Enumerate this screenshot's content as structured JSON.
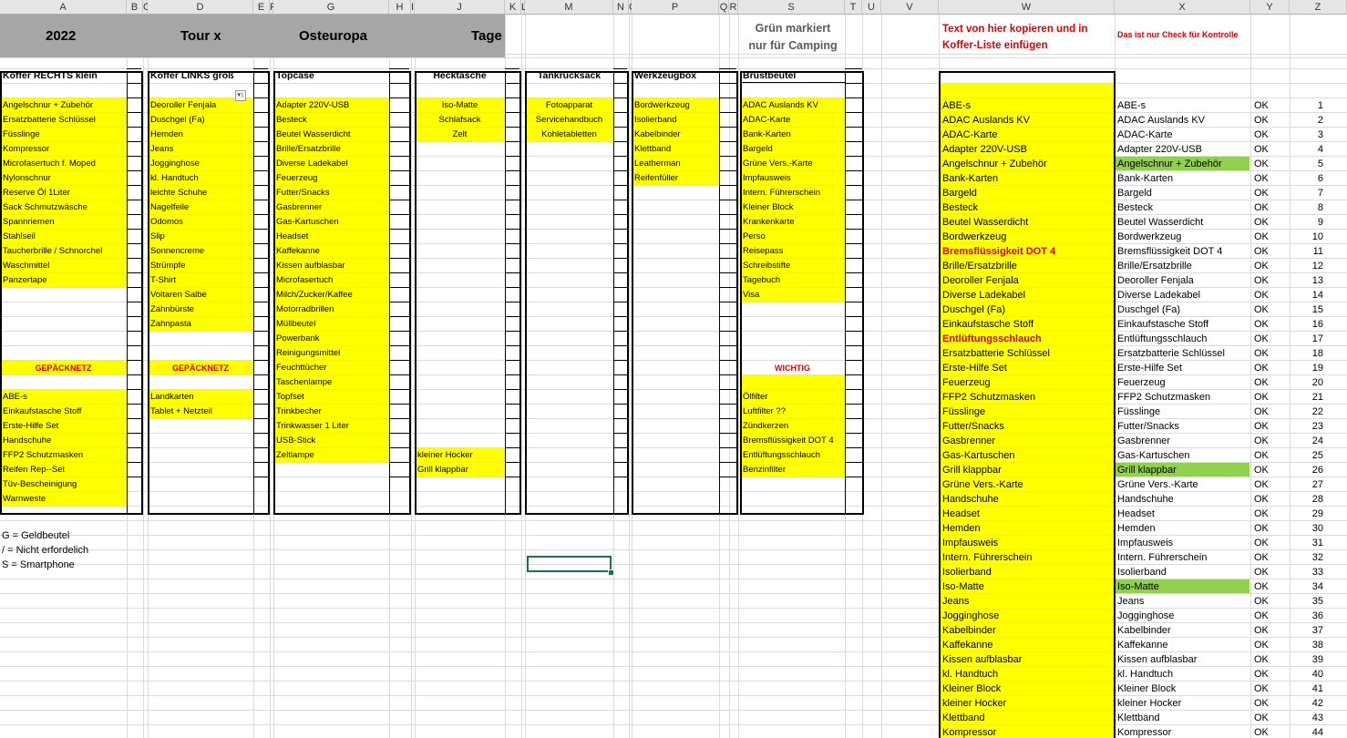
{
  "column_headers": [
    "A",
    "B",
    "C",
    "D",
    "E",
    "F",
    "G",
    "H",
    "I",
    "J",
    "K",
    "L",
    "M",
    "N",
    "O",
    "P",
    "Q",
    "R",
    "S",
    "T",
    "U",
    "V",
    "W",
    "X",
    "Y",
    "Z"
  ],
  "banner": {
    "year": "2022",
    "tour": "Tour x",
    "region": "Osteuropa",
    "days": "Tage"
  },
  "green_note": [
    "Grün markiert",
    "nur für Camping"
  ],
  "copy_note": [
    "Text von hier kopieren und in",
    "Koffer-Liste einfügen"
  ],
  "check_note": "Das ist nur Check für Kontrolle",
  "filter_icon": "sort-filter-icon",
  "colors": {
    "yellow": "#ffff00",
    "green": "#92d050",
    "banner": "#a6a6a6",
    "red": "#e00000",
    "selection": "#1e7145"
  },
  "legend": [
    "G = Geldbeutel",
    "/ = Nicht erfordelich",
    "S = Smartphone"
  ],
  "boxes": {
    "koffer_rechts": {
      "title": "Koffer RECHTS klein",
      "items": [
        "Angelschnur + Zubehör",
        "Ersatzbatterie Schlüssel",
        "Füsslinge",
        "Kompressor",
        "Microfasertuch f. Moped",
        "Nylonschnur",
        "Reserve Öl  1Liter",
        "Sack Schmutzwäsche",
        "Spannriemen",
        "Stahlseil",
        "Taucherbrille / Schnorchel",
        "Waschmittel",
        "Panzertape"
      ],
      "section": "GEPÄCKNETZ",
      "section_items": [
        "ABE-s",
        "Einkaufstasche Stoff",
        "Erste-Hilfe Set",
        "Handschuhe",
        "FFP2 Schutzmasken",
        "Reifen Rep--Set",
        "Tüv-Bescheinigung",
        "Warnweste"
      ]
    },
    "koffer_links": {
      "title": "Koffer LINKS groß",
      "items": [
        "Deoroller Fenjala",
        "Duschgel (Fa)",
        "Hemden",
        "Jeans",
        "Jogginghose",
        "kl. Handtuch",
        "leichte Schuhe",
        "Nagelfeile",
        "Odomos",
        "Slip",
        "Sonnencreme",
        "Strümpfe",
        "T-Shirt",
        "Voltaren Salbe",
        "Zahnbürste",
        "Zahnpasta"
      ],
      "section": "GEPÄCKNETZ",
      "section_items": [
        "Landkarten",
        "Tablet + Netzteil"
      ]
    },
    "topcase": {
      "title": "Topcase",
      "items": [
        "Adapter 220V-USB",
        "Besteck",
        "Beutel Wasserdicht",
        "Brille/Ersatzbrille",
        "Diverse Ladekabel",
        "Feuerzeug",
        "Futter/Snacks",
        "Gasbrenner",
        "Gas-Kartuschen",
        "Headset",
        "Kaffekanne",
        "Kissen aufblasbar",
        "Microfasertuch",
        "Milch/Zucker/Kaffee",
        "Motorradbrillen",
        "Müllbeutel",
        "Powerbank",
        "Reinigungsmittel",
        "Feuchttücher",
        "Taschenlampe",
        "Topfset",
        "Trinkbecher",
        "Trinkwasser 1 Liter",
        "USB-Stick",
        "Zeltlampe"
      ]
    },
    "hecktasche": {
      "title": "Hecktasche",
      "items": [
        "Iso-Matte",
        "Schlafsack",
        "Zelt"
      ],
      "bottom_items": [
        "kleiner Hocker",
        "Grill klappbar"
      ]
    },
    "tankrucksack": {
      "title": "Tankrucksack",
      "items": [
        "Fotoapparat",
        "Servicehandbuch",
        "Kohletabletten"
      ]
    },
    "werkzeugbox": {
      "title": "Werkzeugbox",
      "items": [
        "Bordwerkzeug",
        "Isolierband",
        "Kabelbinder",
        "Klettband",
        "Leatherman",
        "Reifenfüller"
      ]
    },
    "brustbeutel": {
      "title": "Brustbeutel",
      "items": [
        "ADAC Auslands KV",
        "ADAC-Karte",
        "Bank-Karten",
        "Bargeld",
        "Grüne Vers.-Karte",
        "Impfausweis",
        "Intern. Führerschein",
        "Kleiner Block",
        "Krankenkarte",
        "Perso",
        "Reisepass",
        "Schreibstifte",
        "Tagebuch",
        "Visa"
      ],
      "section": "WICHTIG",
      "section_items": [
        "Ölfilter",
        "Luftfilter  ??",
        "Zündkerzen",
        "Bremsflüssigkeit DOT 4",
        "Entlüftungsschlauch",
        "Benzinfilter"
      ]
    }
  },
  "master": {
    "items": [
      "ABE-s",
      "ADAC Auslands KV",
      "ADAC-Karte",
      "Adapter 220V-USB",
      "Angelschnur + Zubehör",
      "Bank-Karten",
      "Bargeld",
      "Besteck",
      "Beutel Wasserdicht",
      "Bordwerkzeug",
      "Bremsflüssigkeit DOT 4",
      "Brille/Ersatzbrille",
      "Deoroller Fenjala",
      "Diverse Ladekabel",
      "Duschgel (Fa)",
      "Einkaufstasche Stoff",
      "Entlüftungsschlauch",
      "Ersatzbatterie Schlüssel",
      "Erste-Hilfe Set",
      "Feuerzeug",
      "FFP2 Schutzmasken",
      "Füsslinge",
      "Futter/Snacks",
      "Gasbrenner",
      "Gas-Kartuschen",
      "Grill klappbar",
      "Grüne Vers.-Karte",
      "Handschuhe",
      "Headset",
      "Hemden",
      "Impfausweis",
      "Intern. Führerschein",
      "Isolierband",
      "Iso-Matte",
      "Jeans",
      "Jogginghose",
      "Kabelbinder",
      "Kaffekanne",
      "Kissen aufblasbar",
      "kl. Handtuch",
      "Kleiner Block",
      "kleiner Hocker",
      "Klettband",
      "Kompressor"
    ],
    "red_items": [
      "Bremsflüssigkeit DOT 4",
      "Entlüftungsschlauch"
    ],
    "green_items": [
      "Angelschnur + Zubehör",
      "Grill klappbar",
      "Iso-Matte"
    ],
    "status": "OK",
    "numbers": [
      1,
      2,
      3,
      4,
      5,
      6,
      7,
      8,
      9,
      10,
      11,
      12,
      13,
      14,
      15,
      16,
      17,
      18,
      19,
      20,
      21,
      22,
      23,
      24,
      25,
      26,
      27,
      28,
      29,
      30,
      31,
      32,
      33,
      34,
      35,
      36,
      37,
      38,
      39,
      40,
      41,
      42,
      43,
      44
    ]
  }
}
